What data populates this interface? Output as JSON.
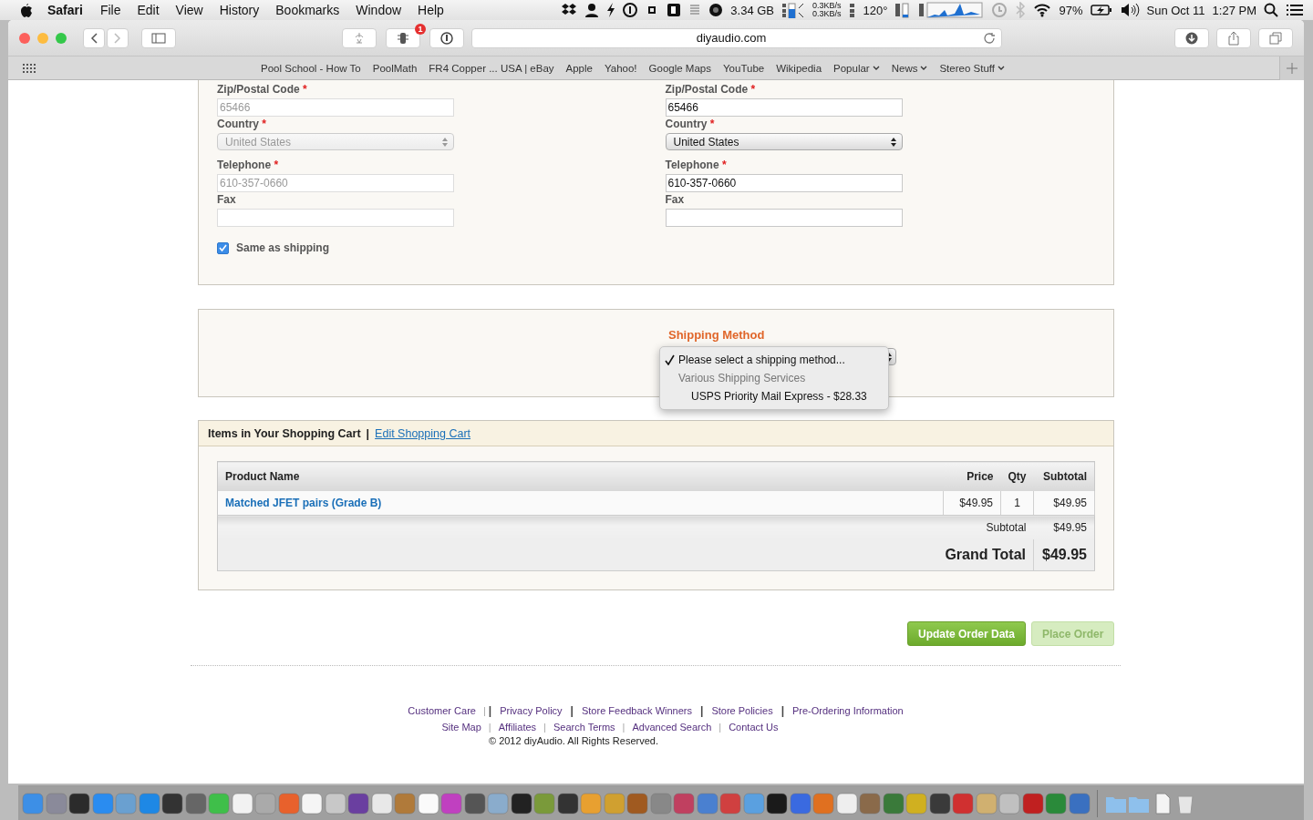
{
  "menubar": {
    "app": "Safari",
    "menus": [
      "File",
      "Edit",
      "View",
      "History",
      "Bookmarks",
      "Window",
      "Help"
    ],
    "status": {
      "memory": "3.34 GB",
      "net_up": "0.3KB/s",
      "net_down": "0.3KB/s",
      "temperature": "120°",
      "battery": "97%",
      "date": "Sun Oct 11",
      "time": "1:27 PM"
    }
  },
  "toolbar": {
    "extension_badge": "1",
    "address": "diyaudio.com"
  },
  "bookmarks": [
    {
      "label": "Pool School - How To",
      "menu": false
    },
    {
      "label": "PoolMath",
      "menu": false
    },
    {
      "label": "FR4 Copper ... USA | eBay",
      "menu": false
    },
    {
      "label": "Apple",
      "menu": false
    },
    {
      "label": "Yahoo!",
      "menu": false
    },
    {
      "label": "Google Maps",
      "menu": false
    },
    {
      "label": "YouTube",
      "menu": false
    },
    {
      "label": "Wikipedia",
      "menu": false
    },
    {
      "label": "Popular",
      "menu": true
    },
    {
      "label": "News",
      "menu": true
    },
    {
      "label": "Stereo Stuff",
      "menu": true
    }
  ],
  "billing": {
    "fields": [
      {
        "label": "Zip/Postal Code",
        "required_mark": "*",
        "kind": "text",
        "value": "65466",
        "disabled": true
      },
      {
        "label": "Country",
        "required_mark": "*",
        "kind": "select",
        "value": "United States",
        "disabled": true
      },
      {
        "label": "Telephone",
        "required_mark": "*",
        "kind": "text",
        "value": "610-357-0660",
        "disabled": true
      },
      {
        "label": "Fax",
        "kind": "text",
        "disabled": true
      }
    ],
    "same_as_shipping": {
      "label": "Same as shipping",
      "checked": true
    }
  },
  "shipping_address": {
    "fields": [
      {
        "label": "Zip/Postal Code",
        "required_mark": "*",
        "kind": "text",
        "value": "65466",
        "disabled": false
      },
      {
        "label": "Country",
        "required_mark": "*",
        "kind": "select",
        "value": "United States",
        "disabled": false
      },
      {
        "label": "Telephone",
        "required_mark": "*",
        "kind": "text",
        "value": "610-357-0660",
        "disabled": false
      },
      {
        "label": "Fax",
        "kind": "text",
        "disabled": false
      }
    ]
  },
  "shipping_method": {
    "title": "Shipping Method",
    "options": [
      {
        "label": "Please select a shipping method...",
        "kind": "option",
        "selected": true
      },
      {
        "label": "Various Shipping Services",
        "kind": "group"
      },
      {
        "label": "USPS Priority Mail Express - $28.33",
        "kind": "option",
        "selected": false
      }
    ]
  },
  "cart": {
    "title": "Items in Your Shopping Cart",
    "separator": "|",
    "edit_link": "Edit Shopping Cart",
    "columns": [
      "Product Name",
      "Price",
      "Qty",
      "Subtotal"
    ],
    "rows": [
      {
        "product": "Matched JFET pairs (Grade B)",
        "price": "$49.95",
        "qty": "1",
        "subtotal": "$49.95"
      }
    ],
    "subtotal_label": "Subtotal",
    "subtotal": "$49.95",
    "grand_total_label": "Grand Total",
    "grand_total": "$49.95"
  },
  "buttons": [
    {
      "label": "Update Order Data",
      "disabled": false
    },
    {
      "label": "Place Order",
      "disabled": true
    }
  ],
  "footer": {
    "link_lines": [
      [
        {
          "kind": "link",
          "label": "Customer Care"
        },
        {
          "kind": "separator",
          "text": "|",
          "strong": false
        },
        {
          "kind": "separator",
          "text": "|",
          "strong": true
        },
        {
          "kind": "link",
          "label": "Privacy Policy"
        },
        {
          "kind": "separator",
          "text": "|",
          "strong": true
        },
        {
          "kind": "link",
          "label": "Store Feedback Winners"
        },
        {
          "kind": "separator",
          "text": "|",
          "strong": true
        },
        {
          "kind": "link",
          "label": "Store Policies"
        },
        {
          "kind": "separator",
          "text": "|",
          "strong": true
        },
        {
          "kind": "link",
          "label": "Pre-Ordering Information"
        }
      ],
      [
        {
          "kind": "link",
          "label": "Site Map"
        },
        {
          "kind": "separator",
          "text": "|",
          "strong": false
        },
        {
          "kind": "link",
          "label": "Affiliates"
        },
        {
          "kind": "separator",
          "text": "|",
          "strong": false
        },
        {
          "kind": "link",
          "label": "Search Terms"
        },
        {
          "kind": "separator",
          "text": "|",
          "strong": false
        },
        {
          "kind": "link",
          "label": "Advanced Search"
        },
        {
          "kind": "separator",
          "text": "|",
          "strong": false
        },
        {
          "kind": "link",
          "label": "Contact Us"
        }
      ]
    ],
    "copyright": "© 2012 diyAudio. All Rights Reserved."
  }
}
